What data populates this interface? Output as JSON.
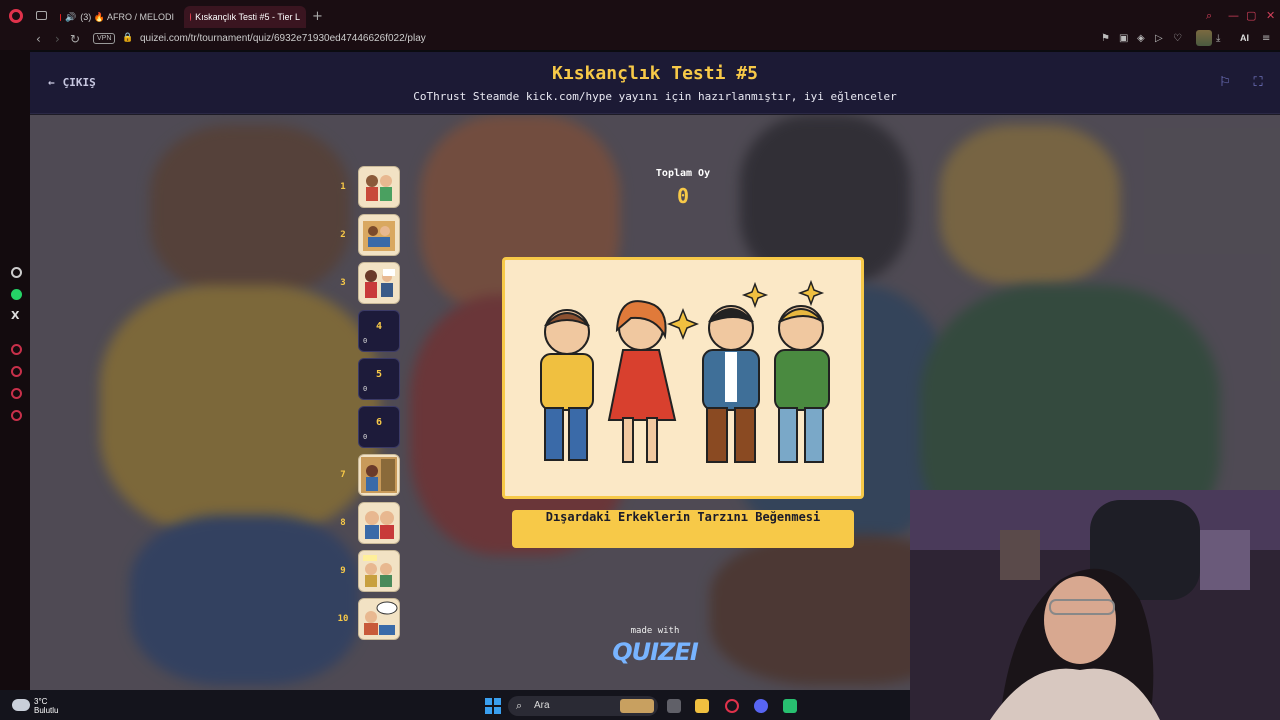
{
  "browser": {
    "tabs": [
      {
        "label": "(3) 🔥 AFRO / MELODI"
      },
      {
        "label": "Kıskançlık Testi #5 - Tier L"
      }
    ],
    "url": "quizei.com/tr/tournament/quiz/6932e71930ed47446626f022/play",
    "vpn_label": "VPN",
    "ai_label": "AI"
  },
  "header": {
    "exit_label": "ÇIKIŞ",
    "title": "Kıskançlık Testi #5",
    "subtitle": "CoThrust Steamde kick.com/hype yayını için hazırlanmıştır, iyi eğlenceler"
  },
  "tier_list": {
    "ranks": [
      "1",
      "2",
      "3",
      "4",
      "5",
      "6",
      "7",
      "8",
      "9",
      "10"
    ],
    "empty_slots": [
      {
        "num": "4",
        "count": "0"
      },
      {
        "num": "5",
        "count": "0"
      },
      {
        "num": "6",
        "count": "0"
      }
    ]
  },
  "vote": {
    "label": "Toplam Oy",
    "count": "0"
  },
  "current_item": {
    "label": "Dışardaki Erkeklerin Tarzını Beğenmesi"
  },
  "footer": {
    "made_with": "made with",
    "brand": "QUIZEI"
  },
  "taskbar": {
    "temperature": "3°C",
    "weather": "Bulutlu",
    "search_placeholder": "Ara"
  },
  "colors": {
    "accent": "#f7c948",
    "header_bg": "#1c1a35",
    "brand": "#78b4ff"
  }
}
